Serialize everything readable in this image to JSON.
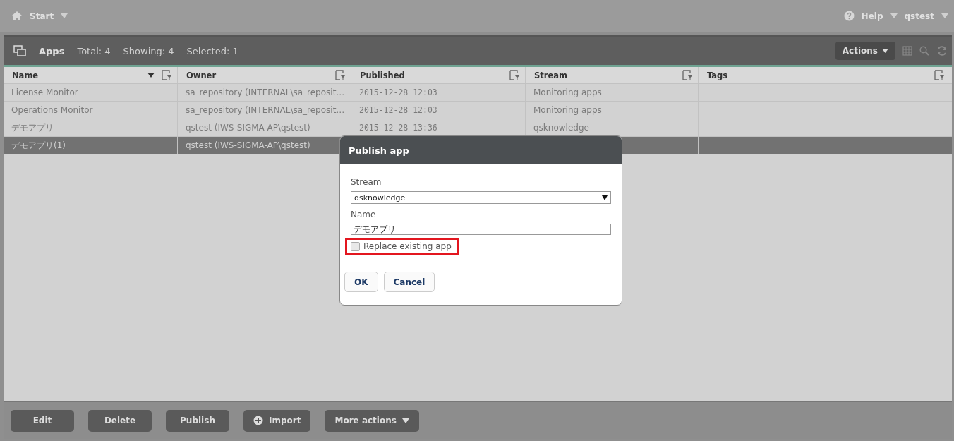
{
  "top_bar": {
    "start": "Start",
    "help": "Help",
    "user": "qstest"
  },
  "apps_header": {
    "title": "Apps",
    "total": "Total: 4",
    "showing": "Showing: 4",
    "selected": "Selected: 1",
    "actions": "Actions"
  },
  "table": {
    "columns": [
      {
        "label": "Name",
        "sorted": true
      },
      {
        "label": "Owner",
        "sorted": false
      },
      {
        "label": "Published",
        "sorted": false
      },
      {
        "label": "Stream",
        "sorted": false
      },
      {
        "label": "Tags",
        "sorted": false
      }
    ],
    "rows": [
      {
        "selected": false,
        "cells": [
          "License Monitor",
          "sa_repository (INTERNAL\\sa_reposit…",
          "2015-12-28 12:03",
          "Monitoring apps",
          null
        ]
      },
      {
        "selected": false,
        "cells": [
          "Operations Monitor",
          "sa_repository (INTERNAL\\sa_reposit…",
          "2015-12-28 12:03",
          "Monitoring apps",
          null
        ]
      },
      {
        "selected": false,
        "cells": [
          "デモアプリ",
          "qstest (IWS-SIGMA-AP\\qstest)",
          "2015-12-28 13:36",
          "qsknowledge",
          null
        ]
      },
      {
        "selected": true,
        "cells": [
          "デモアプリ(1)",
          "qstest (IWS-SIGMA-AP\\qstest)",
          null,
          null,
          null
        ]
      }
    ]
  },
  "dialog": {
    "title": "Publish app",
    "stream_label": "Stream",
    "stream_value": "qsknowledge",
    "name_label": "Name",
    "name_value": "デモアプリ",
    "replace": {
      "label": "Replace existing app",
      "checked": false,
      "highlighted": true
    },
    "buttons": [
      "OK",
      "Cancel"
    ]
  },
  "bottom_bar": {
    "buttons": [
      {
        "label": "Edit",
        "kind": "plain"
      },
      {
        "label": "Delete",
        "kind": "plain"
      },
      {
        "label": "Publish",
        "kind": "plain"
      },
      {
        "label": "Import",
        "kind": "add"
      },
      {
        "label": "More actions",
        "kind": "menu"
      }
    ]
  }
}
